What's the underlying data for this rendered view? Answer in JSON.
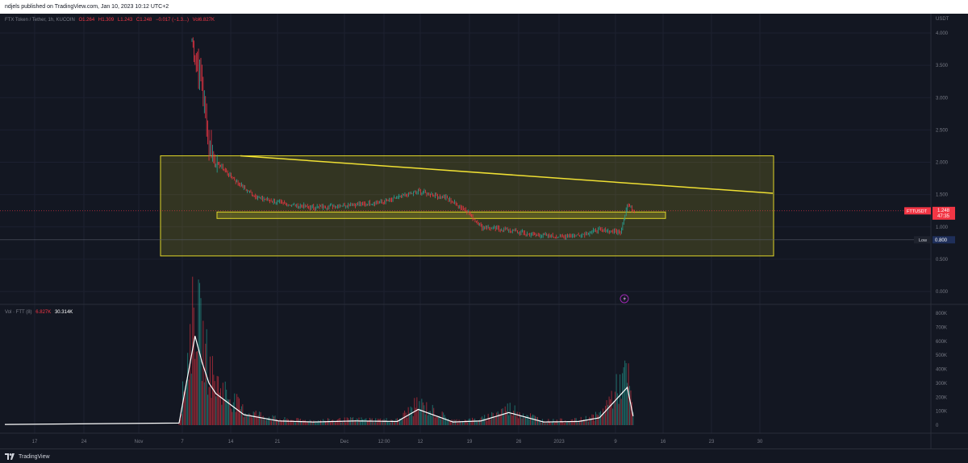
{
  "header": {
    "published": "ndjels published on TradingView.com, Jan 10, 2023 10:12 UTC+2"
  },
  "legend": {
    "symbol": "FTX Token / Tether, 1h, KUCOIN",
    "open": "O1.264",
    "high": "H1.309",
    "low": "L1.243",
    "close": "C1.248",
    "change": "−0.017 (−1.3...)",
    "vol": "Vol6.827K"
  },
  "price_axis": {
    "currency": "USDT",
    "ticks": [
      "4.000",
      "3.500",
      "3.000",
      "2.500",
      "2.000",
      "1.500",
      "1.000",
      "0.500",
      "0.000"
    ]
  },
  "price_tags": {
    "symbol": "FTTUSDT",
    "last": "1.248",
    "countdown": "47:35",
    "low_label": "Low",
    "low_value": "0.800"
  },
  "volume": {
    "legend_label": "Vol · FTT (8)",
    "legend_value1": "6.827K",
    "legend_value2": "30.314K",
    "ticks": [
      "800K",
      "700K",
      "600K",
      "500K",
      "400K",
      "300K",
      "200K",
      "100K",
      "0"
    ]
  },
  "time_axis": {
    "labels": [
      "17",
      "24",
      "Nov",
      "7",
      "14",
      "21",
      "Dec",
      "12:00",
      "12",
      "19",
      "26",
      "2023",
      "9",
      "16",
      "23",
      "30"
    ]
  },
  "footer": {
    "brand": "TradingView"
  },
  "chart_data": {
    "type": "candlestick",
    "symbol": "FTX Token / Tether",
    "interval": "1h",
    "exchange": "KUCOIN",
    "currency": "USDT",
    "ylim": [
      0,
      4.2
    ],
    "series": [
      {
        "name": "",
        "x": [
          "Nov 7",
          "Nov 8",
          "Nov 9",
          "Nov 10",
          "Nov 11",
          "Nov 12",
          "Nov 13",
          "Nov 14",
          "Nov 15",
          "Nov 17",
          "Nov 21",
          "Nov 25",
          "Dec 1",
          "Dec 5",
          "Dec 10",
          "Dec 14",
          "Dec 17",
          "Dec 19",
          "Dec 23",
          "Dec 26",
          "Dec 30",
          "Jan 2",
          "Jan 5",
          "Jan 8",
          "Jan 9",
          "Jan 10"
        ],
        "values": [
          3.9,
          3.7,
          3.2,
          2.3,
          2.0,
          1.9,
          1.8,
          1.7,
          1.6,
          1.45,
          1.35,
          1.3,
          1.35,
          1.38,
          1.55,
          1.45,
          1.25,
          1.0,
          0.95,
          0.88,
          0.85,
          0.87,
          0.95,
          0.92,
          1.35,
          1.248
        ]
      }
    ],
    "volume_series": {
      "name": "",
      "x": [
        "Nov 7",
        "Nov 8",
        "Nov 9",
        "Nov 10",
        "Nov 11",
        "Nov 13",
        "Nov 15",
        "Nov 20",
        "Nov 25",
        "Dec 1",
        "Dec 7",
        "Dec 10",
        "Dec 15",
        "Dec 19",
        "Dec 23",
        "Dec 28",
        "Jan 2",
        "Jan 5",
        "Jan 9",
        "Jan 10"
      ],
      "values": [
        20000,
        850000,
        600000,
        400000,
        300000,
        200000,
        100000,
        40000,
        30000,
        40000,
        35000,
        150000,
        30000,
        40000,
        120000,
        30000,
        35000,
        70000,
        360000,
        30314
      ]
    },
    "drawings": [
      {
        "type": "rectangle",
        "price_top": 2.1,
        "price_bottom": 0.55
      },
      {
        "type": "rectangle",
        "price_top": 1.23,
        "price_bottom": 1.13
      },
      {
        "type": "trendline",
        "price_start": 2.1,
        "price_end": 1.52
      }
    ]
  }
}
